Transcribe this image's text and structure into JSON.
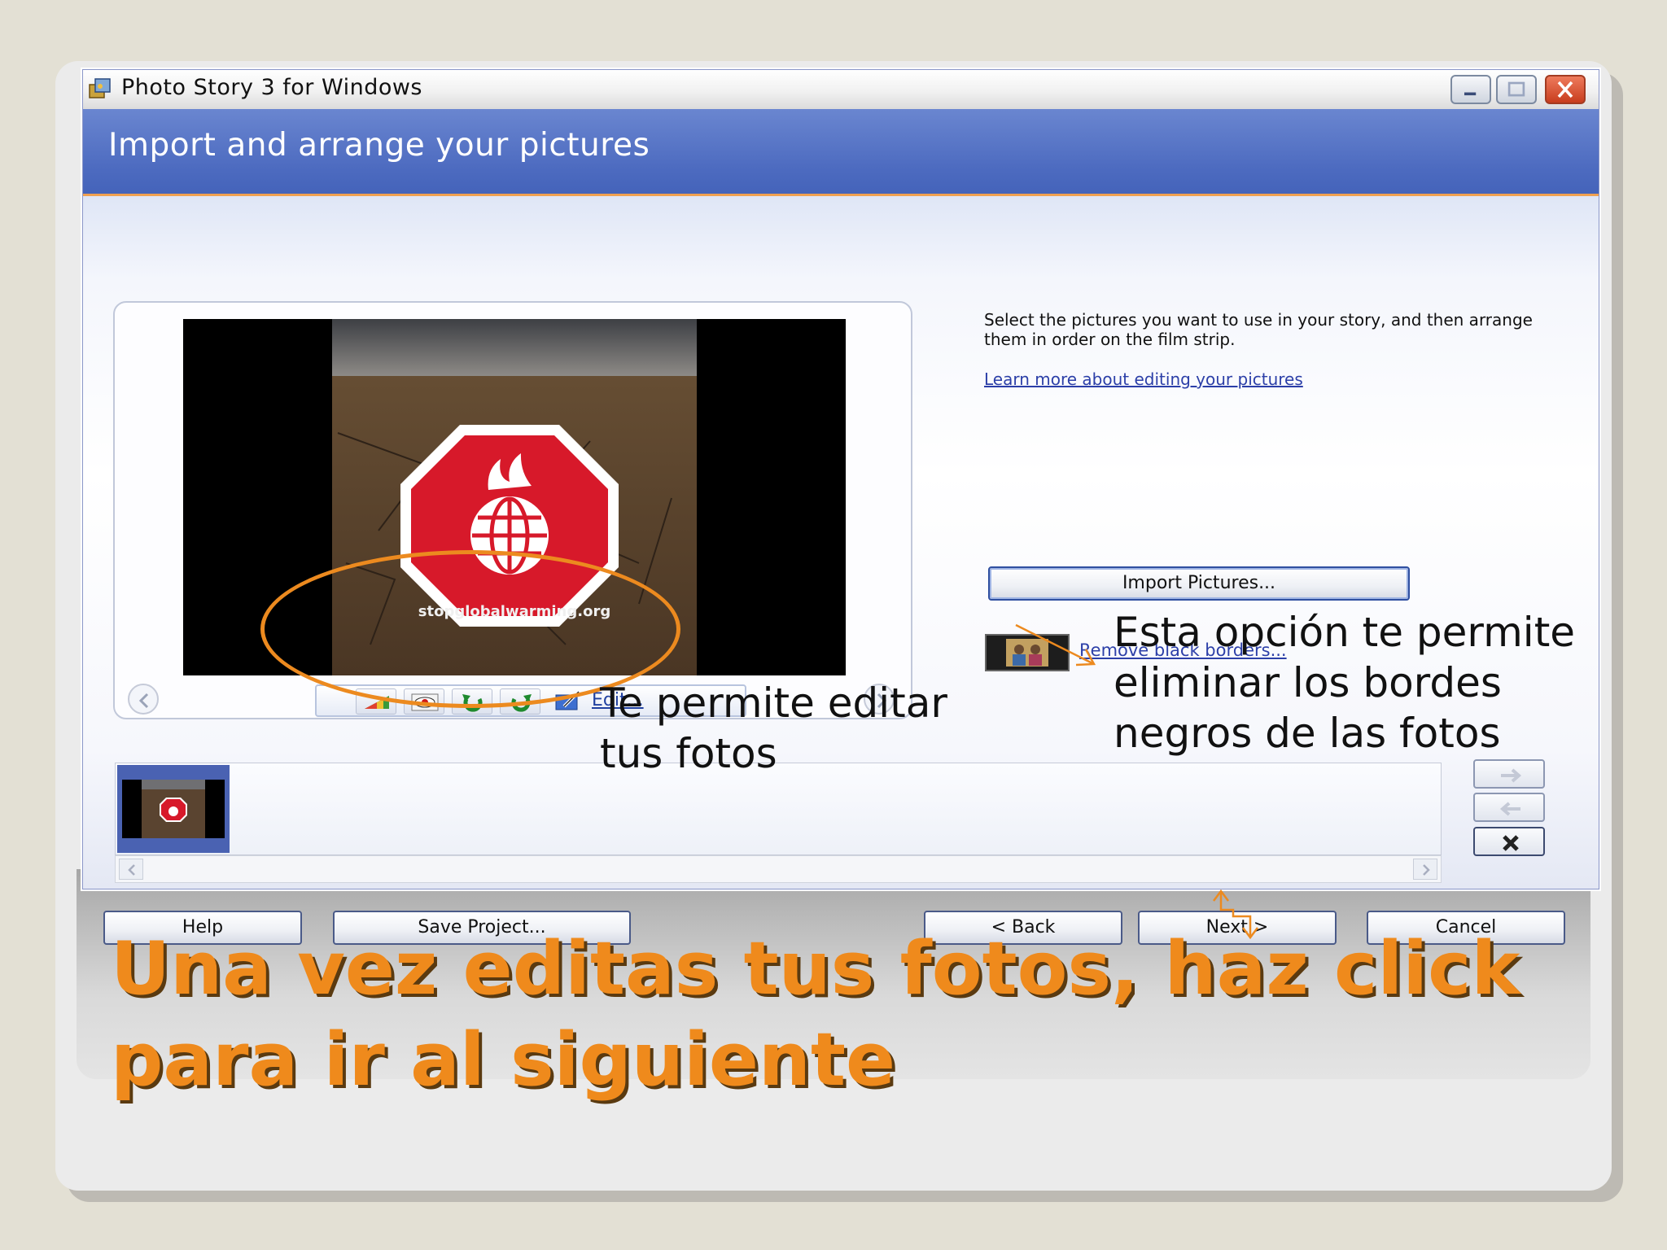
{
  "window": {
    "title": "Photo Story 3 for Windows",
    "header_title": "Import and arrange your pictures"
  },
  "preview": {
    "watermark_text": "stopglobalwarming.org",
    "edit_link": "Edit..."
  },
  "toolbar": {
    "tools": [
      "auto-correct-icon",
      "red-eye-icon",
      "rotate-left-icon",
      "rotate-right-icon",
      "edit-icon"
    ]
  },
  "instructions": {
    "text": "Select the pictures you want to use in your story, and then arrange them in order on the film strip.",
    "learn_link": "Learn more about editing your pictures"
  },
  "import_button": "Import Pictures...",
  "remove_borders_link": "Remove black borders...",
  "footer": {
    "help": "Help",
    "save": "Save Project...",
    "back": "< Back",
    "next": "Next >",
    "cancel": "Cancel"
  },
  "annotations": {
    "edit_note": "Te permite editar tus fotos",
    "borders_note": "Esta opción te permite eliminar los bordes negros de las fotos",
    "caption": "Una vez editas tus fotos, haz click para ir al siguiente"
  },
  "colors": {
    "accent_orange": "#ef8a1c",
    "header_blue": "#4d6bc0",
    "link_blue": "#2c3fa8"
  }
}
